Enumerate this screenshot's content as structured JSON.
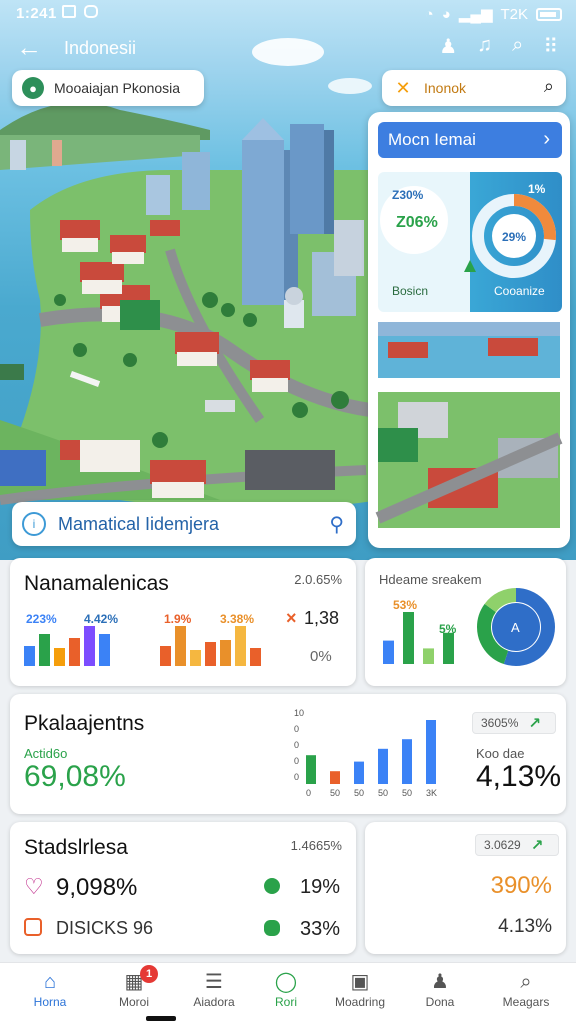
{
  "status_bar": {
    "time": "1:241",
    "right_text": "T2K"
  },
  "app_bar": {
    "title": "Indonesii"
  },
  "hero": {
    "location_pill": "Mooaiajan Pkonosia",
    "search_pill": "Inonok",
    "panel_button": "Mocn Iemai",
    "panel_stats": [
      "Z30%",
      "Z06%",
      "1%",
      "29%"
    ],
    "panel_label_left": "Bosicn",
    "panel_label_right": "Cooanize",
    "caption": "Mamatical Iidemjera"
  },
  "card_market": {
    "title": "Nanamalenicas",
    "value": "2.0.65%",
    "pcts": [
      "223%",
      "4.42%",
      "1.9%",
      "3.38%"
    ],
    "side_value": "1,38",
    "side_small": "0%",
    "colors": [
      "#3b82f6",
      "#2aa24a",
      "#f59e0b",
      "#e9602a",
      "#7c4dff"
    ],
    "chart_data": {
      "type": "bar",
      "left_group": [
        0.5,
        0.8,
        0.45,
        0.7,
        1.0,
        0.8
      ],
      "right_group": [
        0.5,
        1.0,
        0.4,
        0.6,
        0.65,
        1.0,
        0.45
      ]
    }
  },
  "card_hm": {
    "title": "Hdeame sreakem",
    "pcts": [
      "53%",
      "5%"
    ],
    "donut_label": "A",
    "chart_data": {
      "type": "bar",
      "values": [
        0.45,
        1.0,
        0.3,
        0.6
      ],
      "donut": [
        0.55,
        0.3,
        0.15
      ]
    }
  },
  "card_perf": {
    "title": "Pkalaajentns",
    "sub": "Actid6o",
    "big_value": "69,08%",
    "y_ticks": [
      "10",
      "0",
      "0",
      "0",
      "0"
    ],
    "x_ticks": [
      "0",
      "50",
      "50",
      "50",
      "50",
      "3K"
    ],
    "chip": "3605%",
    "right_sub": "Koo dae",
    "right_value": "4,13%",
    "chart_data": {
      "type": "bar",
      "values": [
        0.45,
        0.2,
        0.35,
        0.55,
        0.7,
        1.0
      ]
    }
  },
  "card_stats": {
    "title": "Stadslrlesa",
    "value": "1.4665%",
    "row1_value": "9,098%",
    "row1_pct": "19%",
    "row2_value": "DISICKS 96",
    "row2_pct": "33%"
  },
  "card_right_small": {
    "chip": "3.0629",
    "value_orange": "390%",
    "value_small": "4.13%"
  },
  "nav": {
    "items": [
      {
        "label": "Horna",
        "icon": "⌂"
      },
      {
        "label": "Moroi",
        "icon": "▦"
      },
      {
        "label": "Aiadora",
        "icon": "☰"
      },
      {
        "label": "Rori",
        "icon": "◯"
      },
      {
        "label": "Moadring",
        "icon": "▣"
      },
      {
        "label": "Dona",
        "icon": "♟"
      },
      {
        "label": "Meagars",
        "icon": "⌕"
      }
    ],
    "badge": "1"
  }
}
